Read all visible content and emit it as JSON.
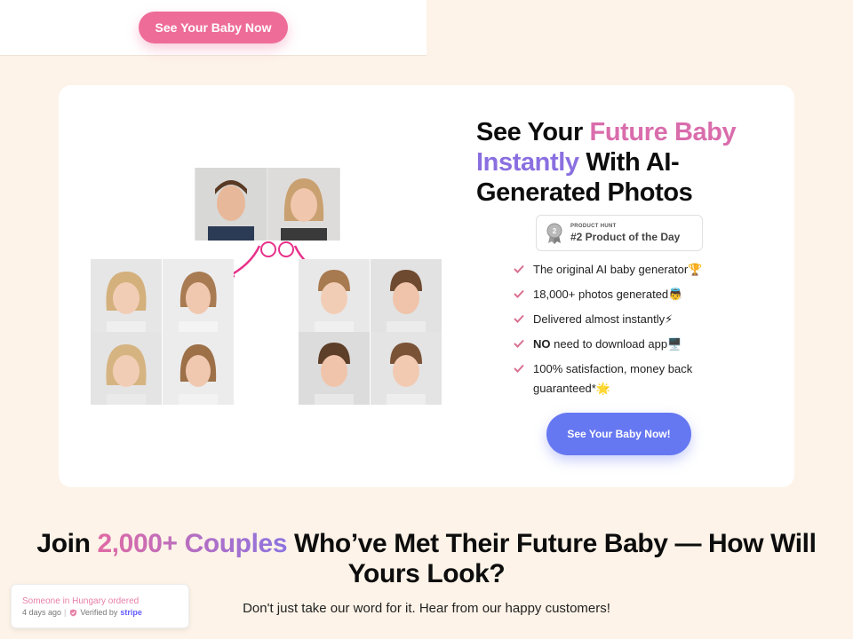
{
  "header": {
    "cta_label": "See Your Baby Now"
  },
  "hero": {
    "title_part1": "See Your ",
    "title_highlight1": "Future Baby",
    "title_highlight2": "Instantly",
    "title_part2": " With AI-Generated Photos",
    "badge": {
      "small": "PRODUCT HUNT",
      "big": "#2 Product of the Day"
    },
    "features": [
      {
        "text": "The original AI baby generator🏆"
      },
      {
        "text": "18,000+ photos generated👼"
      },
      {
        "text": "Delivered almost instantly⚡"
      },
      {
        "bold": "NO",
        "text": " need to download app🖥️"
      },
      {
        "text": "100% satisfaction, money back guaranteed*🌟"
      }
    ],
    "cta_label": "See Your Baby Now!"
  },
  "social": {
    "title_part1": "Join ",
    "title_highlight": "2,000+ Couples",
    "title_part2": " Who’ve Met Their Future Baby — How Will Yours Look?",
    "subtitle": "Don't just take our word for it. Hear from our happy customers!"
  },
  "toast": {
    "line1": "Someone in Hungary ordered",
    "time": "4 days ago",
    "verified": "Verified by",
    "stripe": "stripe"
  },
  "colors": {
    "pink": "#ee6d98",
    "blue": "#6677f2",
    "background": "#fdf3e8"
  },
  "icons": [
    "medal-icon",
    "check-icon",
    "arrow-left-icon",
    "arrow-right-icon",
    "shield-check-icon"
  ]
}
